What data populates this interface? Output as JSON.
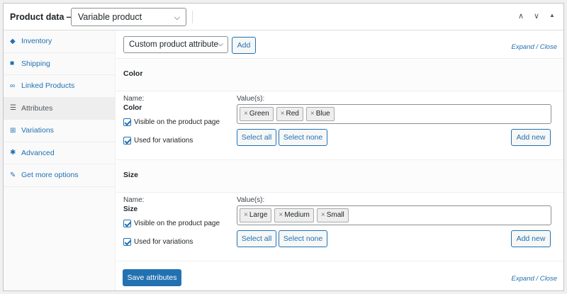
{
  "header": {
    "title": "Product data —",
    "product_type": "Variable product",
    "icons": [
      "chevron-up-icon",
      "chevron-down-icon",
      "collapse-arrow-icon"
    ]
  },
  "sidebar": {
    "items": [
      {
        "label": "Inventory",
        "icon": "tag-icon"
      },
      {
        "label": "Shipping",
        "icon": "truck-icon"
      },
      {
        "label": "Linked Products",
        "icon": "link-icon"
      },
      {
        "label": "Attributes",
        "icon": "list-icon",
        "active": true
      },
      {
        "label": "Variations",
        "icon": "grid-icon"
      },
      {
        "label": "Advanced",
        "icon": "gear-icon"
      },
      {
        "label": "Get more options",
        "icon": "plugin-icon"
      }
    ]
  },
  "toolbar": {
    "attribute_select": "Custom product attribute",
    "add_label": "Add",
    "expand": "Expand",
    "close": "Close"
  },
  "attributes": [
    {
      "title": "Color",
      "name_label": "Name:",
      "name_value": "Color",
      "values_label": "Value(s):",
      "values": [
        "Green",
        "Red",
        "Blue"
      ],
      "visible_label": "Visible on the product page",
      "variations_label": "Used for variations",
      "select_all": "Select all",
      "select_none": "Select none",
      "add_new": "Add new"
    },
    {
      "title": "Size",
      "name_label": "Name:",
      "name_value": "Size",
      "values_label": "Value(s):",
      "values": [
        "Large",
        "Medium",
        "Small"
      ],
      "visible_label": "Visible on the product page",
      "variations_label": "Used for variations",
      "select_all": "Select all",
      "select_none": "Select none",
      "add_new": "Add new"
    }
  ],
  "footer": {
    "save_label": "Save attributes",
    "expand": "Expand",
    "close": "Close"
  },
  "colors": {
    "accent": "#2271b1",
    "border": "#c3c4c7"
  }
}
